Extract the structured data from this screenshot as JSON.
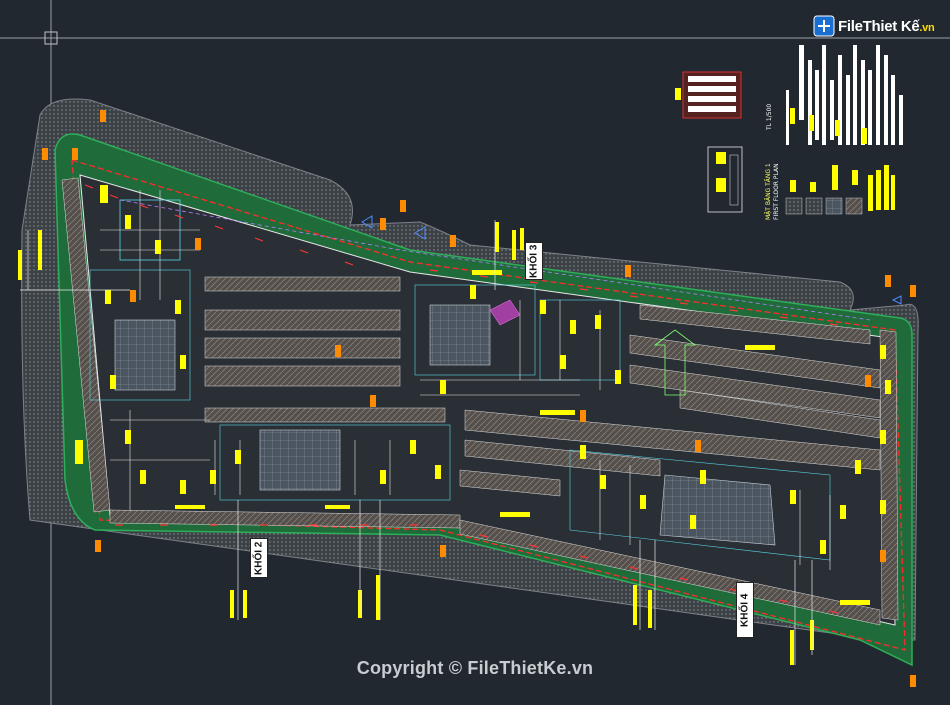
{
  "watermark": {
    "copyright": "Copyright © FileThietKe.vn"
  },
  "logo": {
    "brand": "FileThiet Kế",
    "tld": ".vn"
  },
  "blocks": {
    "khoi2": "KHỐI 2",
    "khoi3": "KHỐI 3",
    "khoi4": "KHỐI 4"
  },
  "legend": {
    "title_vn": "MẶT BẰNG TẦNG 1",
    "title_en": "FIRST FLOOR PLAN",
    "scale": "TL 1/500"
  },
  "colors": {
    "background": "#212830",
    "site_green": "#1f6b3a",
    "boundary": "#ff2b2b",
    "walls": "#e8e8e8",
    "annotation": "#ffff00",
    "marker": "#ff8c00",
    "building_fill": "#5a5550",
    "hatch": "#7a7672"
  },
  "icons": [
    "crosshair-icon",
    "logo-icon"
  ]
}
